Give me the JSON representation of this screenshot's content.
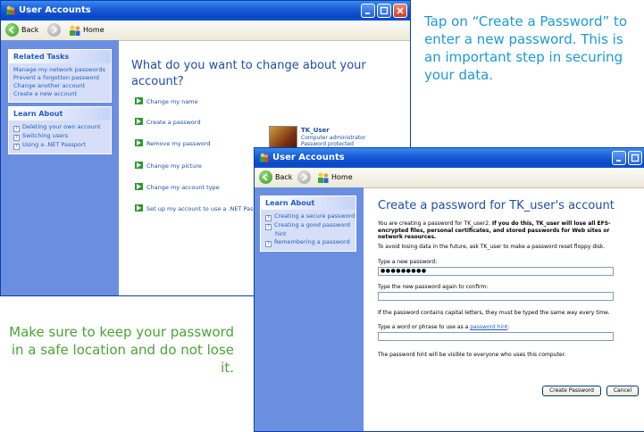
{
  "captions": {
    "top": "Tap on “Create a Password” to enter a new password. This is an important step in securing your data.",
    "bottom": "Make sure to keep your password in a safe location and do not lose it."
  },
  "window1": {
    "title": "User Accounts",
    "toolbar": {
      "back": "Back",
      "home": "Home"
    },
    "related_tasks": {
      "heading": "Related Tasks",
      "links": [
        "Manage my network passwords",
        "Prevent a forgotten password",
        "Change another account",
        "Create a new account"
      ]
    },
    "learn_about": {
      "heading": "Learn About",
      "links": [
        "Deleting your own account",
        "Switching users",
        "Using a .NET Passport"
      ]
    },
    "heading": "What do you want to change about your account?",
    "tasks": [
      "Change my name",
      "Create a password",
      "Remove my password",
      "Change my picture",
      "Change my account type",
      "Set up my account to use a .NET Passport"
    ],
    "user": {
      "name": "TK_User",
      "role_line1": "Computer administrator",
      "role_line2": "Password protected"
    }
  },
  "window2": {
    "title": "User Accounts",
    "toolbar": {
      "back": "Back",
      "home": "Home"
    },
    "learn_about": {
      "heading": "Learn About",
      "links": [
        "Creating a secure password",
        "Creating a good password hint",
        "Remembering a password"
      ]
    },
    "heading": "Create a password for TK_user's account",
    "desc_normal": "You are creating a password for TK_user2.",
    "desc_bold": "If you do this, TK_user will lose all EFS-encrypted files, personal certificates, and stored passwords for Web sites or network resources.",
    "warning": "To avoid losing data in the future, ask TK_user to make a password reset floppy disk.",
    "new_password_label": "Type a new password:",
    "new_password_value": "●●●●●●●●●",
    "confirm_label": "Type the new password again to confirm:",
    "confirm_value": "",
    "caps_note": "If the password contains capital letters, they must be typed the same way every time.",
    "hint_label_prefix": "Type a word or phrase to use as a",
    "hint_link": "password hint",
    "hint_label_suffix": ":",
    "hint_value": "",
    "hint_note": "The password hint will be visible to everyone who uses this computer.",
    "create_button": "Create Password",
    "cancel_button": "Cancel"
  },
  "colors": {
    "titlebar": "#0a47c6",
    "panel": "#6b8fe0",
    "link": "#215dc6",
    "caption_blue": "#1b9ad6",
    "caption_green": "#4aa535"
  }
}
